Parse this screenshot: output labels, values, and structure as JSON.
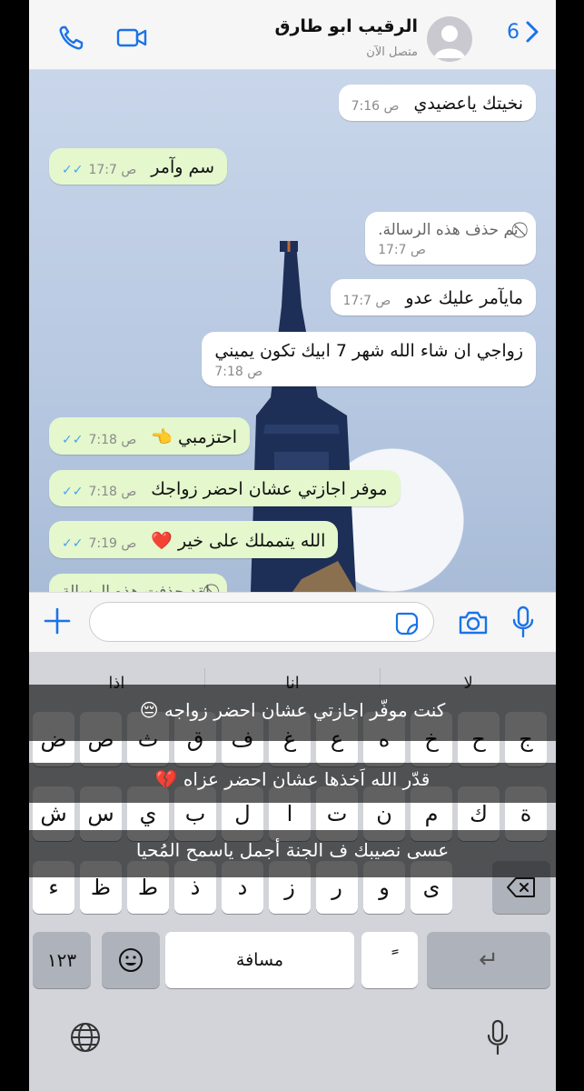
{
  "header": {
    "back_count": "6",
    "contact_name": "الرقيب ابو طارق",
    "contact_status": "متصل الآن"
  },
  "messages": [
    {
      "dir": "in",
      "text": "نخيتك ياعضيدي",
      "time": "7:16 ص"
    },
    {
      "dir": "out",
      "text": "سم وآمر",
      "time": "17:7 ص"
    },
    {
      "dir": "in",
      "text": "تم حذف هذه الرسالة.",
      "time": "17:7 ص",
      "deleted": true
    },
    {
      "dir": "in",
      "text": "مايآمر عليك عدو",
      "time": "17:7 ص"
    },
    {
      "dir": "in",
      "text": "زواجي ان شاء الله شهر 7 ابيك تكون يميني",
      "time": "7:18 ص"
    },
    {
      "dir": "out",
      "text": "احتزمبي 👈",
      "time": "7:18 ص"
    },
    {
      "dir": "out",
      "text": "موفر اجازتي عشان احضر زواجك",
      "time": "7:18 ص"
    },
    {
      "dir": "out",
      "text": "الله يتمملك على خير ❤️",
      "time": "7:19 ص"
    },
    {
      "dir": "out",
      "text": "لقد حذفت هذه الرسالة",
      "deleted": true
    }
  ],
  "input": {
    "placeholder": ""
  },
  "keyboard": {
    "suggestions": [
      "اذا",
      "انا",
      "لا"
    ],
    "row1": [
      "ض",
      "ص",
      "ث",
      "ق",
      "ف",
      "غ",
      "ع",
      "ه",
      "خ",
      "ح",
      "ج"
    ],
    "row2": [
      "ش",
      "س",
      "ي",
      "ب",
      "ل",
      "ا",
      "ت",
      "ن",
      "م",
      "ك",
      "ة"
    ],
    "row3": [
      "ء",
      "ظ",
      "ط",
      "ذ",
      "د",
      "ز",
      "ر",
      "و",
      "ى"
    ],
    "numbers_label": "١٢٣",
    "space_label": "مسافة",
    "diacritic_label": "ً",
    "return_label": "↵"
  },
  "captions": [
    "كنت موفّر اجازتي عشان احضر زواجه 😔",
    "قدّر الله اَخذها عشان احضر عزاه 💔",
    "عسى نصيبك ف الجنة أجمل ياسمح المُحيا"
  ],
  "colors": {
    "accent": "#1a73e8",
    "outgoing": "#e4f7cd",
    "read_ticks": "#4aa3ef"
  }
}
